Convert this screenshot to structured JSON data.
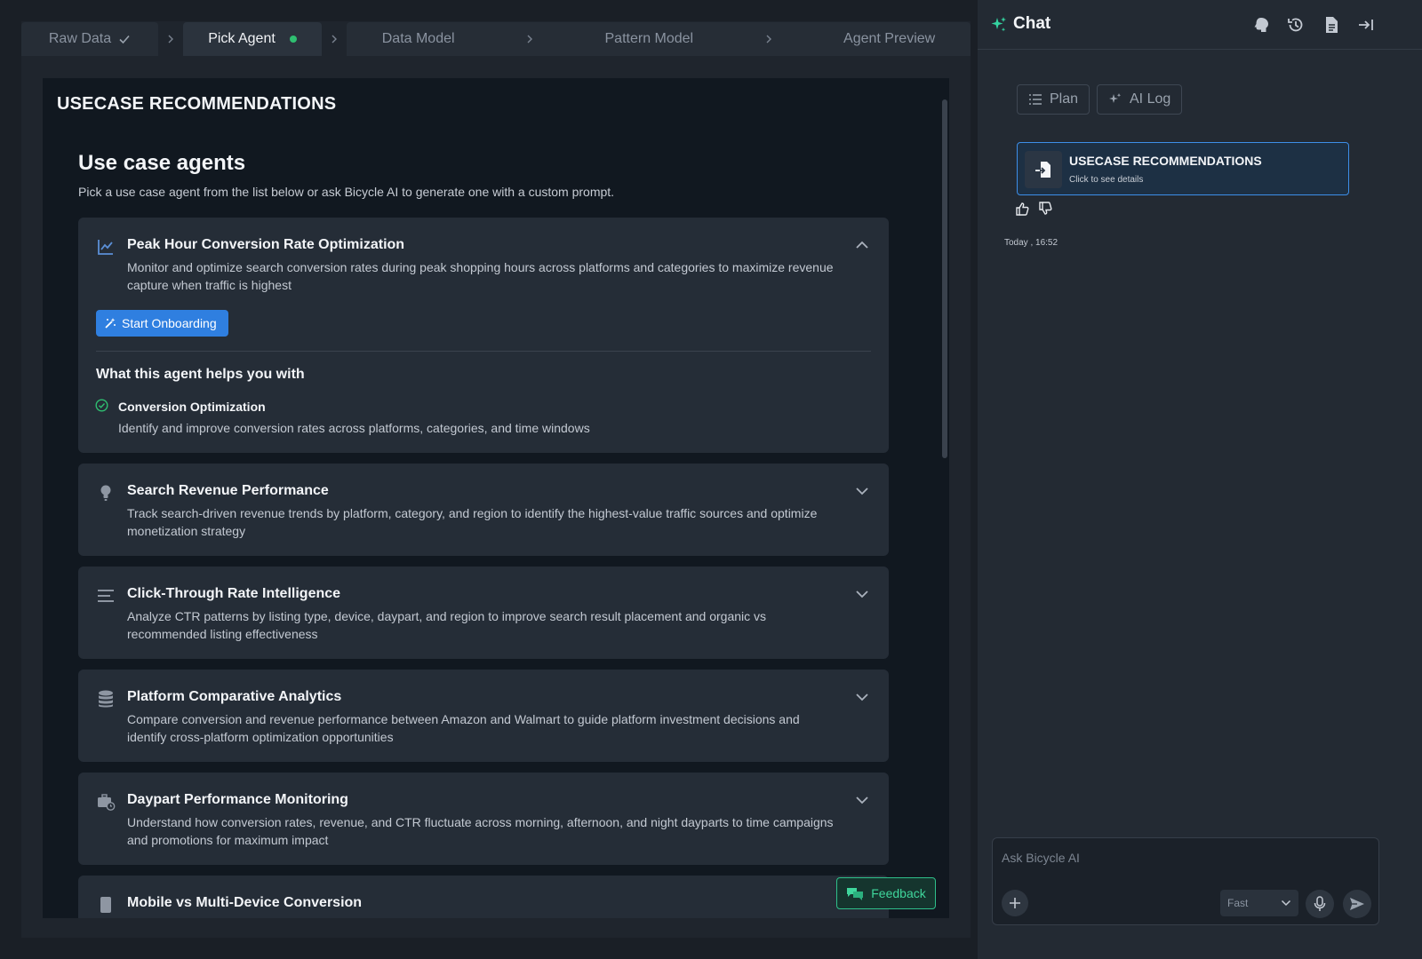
{
  "stepper": {
    "steps": [
      {
        "label": "Raw Data",
        "state": "done"
      },
      {
        "label": "Pick Agent",
        "state": "active"
      },
      {
        "label": "Data Model",
        "state": "pending"
      },
      {
        "label": "Pattern Model",
        "state": "pending"
      },
      {
        "label": "Agent Preview",
        "state": "pending"
      }
    ]
  },
  "main": {
    "section_title": "USECASE RECOMMENDATIONS",
    "heading": "Use case agents",
    "subheading": "Pick a use case agent from the list below or ask Bicycle AI to generate one with a custom prompt.",
    "cards": [
      {
        "icon": "line-chart-icon",
        "title": "Peak Hour Conversion Rate Optimization",
        "description": "Monitor and optimize search conversion rates during peak shopping hours across platforms and categories to maximize revenue capture when traffic is highest",
        "expanded": true,
        "action_label": "Start Onboarding",
        "helps_title": "What this agent helps you with",
        "features": [
          {
            "title": "Conversion Optimization",
            "description": "Identify and improve conversion rates across platforms, categories, and time windows"
          }
        ]
      },
      {
        "icon": "lightbulb-icon",
        "title": "Search Revenue Performance",
        "description": "Track search-driven revenue trends by platform, category, and region to identify the highest-value traffic sources and optimize monetization strategy",
        "expanded": false
      },
      {
        "icon": "lines-icon",
        "title": "Click-Through Rate Intelligence",
        "description": "Analyze CTR patterns by listing type, device, daypart, and region to improve search result placement and organic vs recommended listing effectiveness",
        "expanded": false
      },
      {
        "icon": "database-icon",
        "title": "Platform Comparative Analytics",
        "description": "Compare conversion and revenue performance between Amazon and Walmart to guide platform investment decisions and identify cross-platform optimization opportunities",
        "expanded": false
      },
      {
        "icon": "briefcase-clock-icon",
        "title": "Daypart Performance Monitoring",
        "description": "Understand how conversion rates, revenue, and CTR fluctuate across morning, afternoon, and night dayparts to time campaigns and promotions for maximum impact",
        "expanded": false
      },
      {
        "icon": "device-icon",
        "title": "Mobile vs Multi-Device Conversion",
        "description": "",
        "expanded": false
      }
    ],
    "feedback_label": "Feedback"
  },
  "chat": {
    "title": "Chat",
    "chips": [
      {
        "label": "Plan",
        "icon": "list-icon"
      },
      {
        "label": "AI Log",
        "icon": "sparkle-icon"
      }
    ],
    "message_card": {
      "title": "USECASE RECOMMENDATIONS",
      "subtitle": "Click to see details"
    },
    "timestamp": "Today , 16:52",
    "composer": {
      "placeholder": "Ask Bicycle AI",
      "value": "",
      "model": "Fast"
    }
  },
  "colors": {
    "accent": "#2f7fe0",
    "success": "#2fbf71",
    "teal": "#3fd69c",
    "card_bg": "#252d37",
    "page_bg": "#111820"
  }
}
